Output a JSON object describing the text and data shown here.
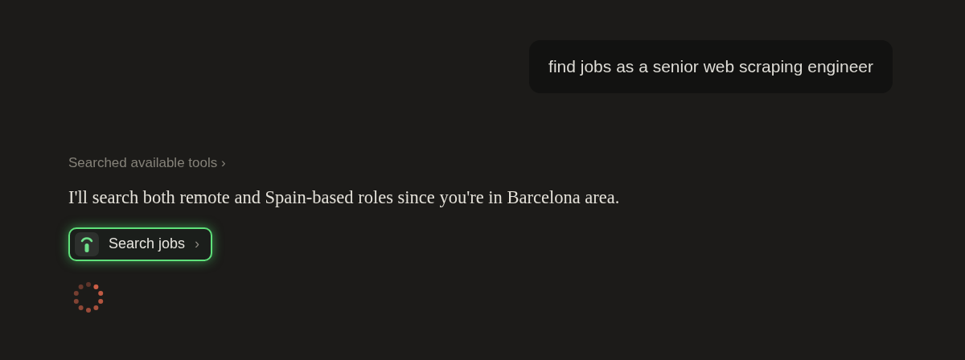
{
  "user_message": {
    "text": "find jobs as a senior web scraping engineer"
  },
  "tool_summary": {
    "label": "Searched available tools",
    "chevron": "›"
  },
  "assistant_message": {
    "text": "I'll search both remote and Spain-based roles since you're in Barcelona area."
  },
  "tool_call": {
    "label": "Search jobs",
    "chevron": "›",
    "active": true
  },
  "loading": true
}
